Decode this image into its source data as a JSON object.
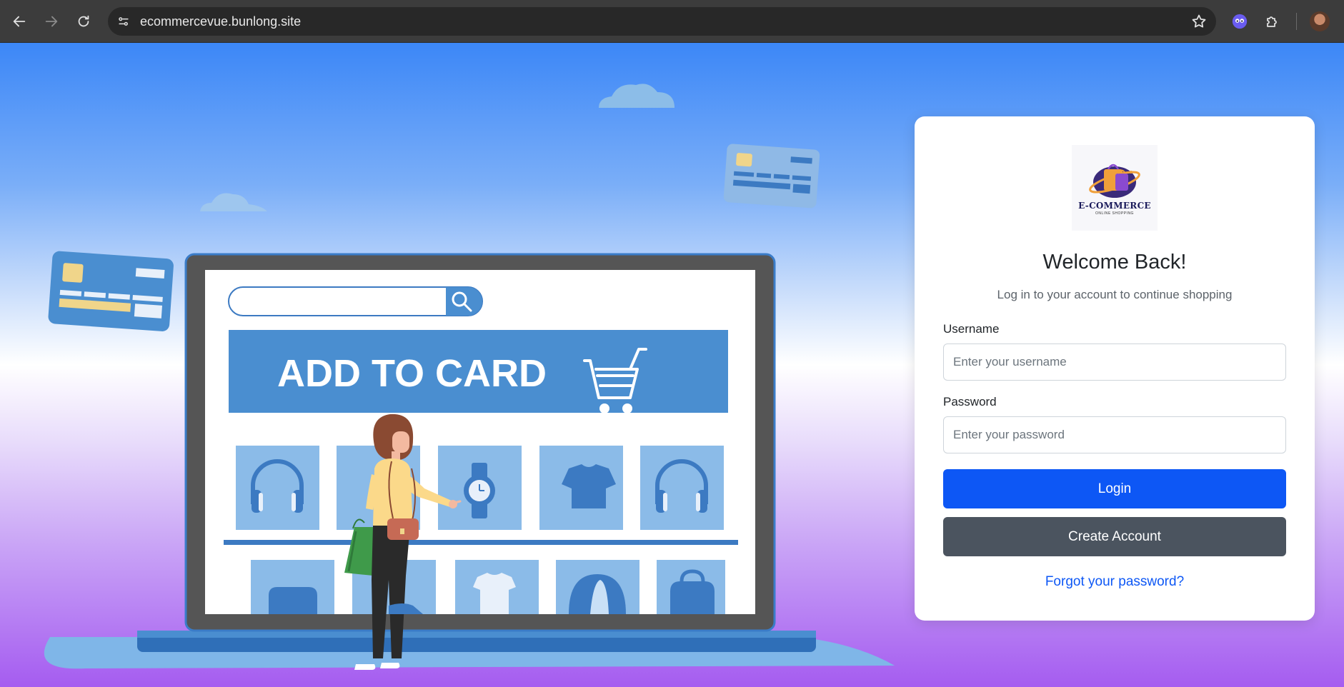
{
  "browser": {
    "url": "ecommercevue.bunlong.site",
    "icons": [
      "back-arrow-icon",
      "forward-arrow-icon",
      "reload-icon",
      "site-info-icon",
      "bookmark-star-icon",
      "extension-icon",
      "puzzle-icon",
      "profile-avatar"
    ]
  },
  "illustration": {
    "banner_text": "ADD  TO CARD"
  },
  "login": {
    "logo_brand": "E-COMMERCE",
    "logo_tagline": "ONLINE SHOPPING",
    "title": "Welcome Back!",
    "subtitle": "Log in to your account to continue shopping",
    "username_label": "Username",
    "username_placeholder": "Enter your username",
    "password_label": "Password",
    "password_placeholder": "Enter your password",
    "login_button": "Login",
    "create_button": "Create Account",
    "forgot_link": "Forgot your password?"
  },
  "colors": {
    "primary": "#0d57f5",
    "secondary": "#4b545f",
    "illustration_blue": "#4a8ed0"
  }
}
